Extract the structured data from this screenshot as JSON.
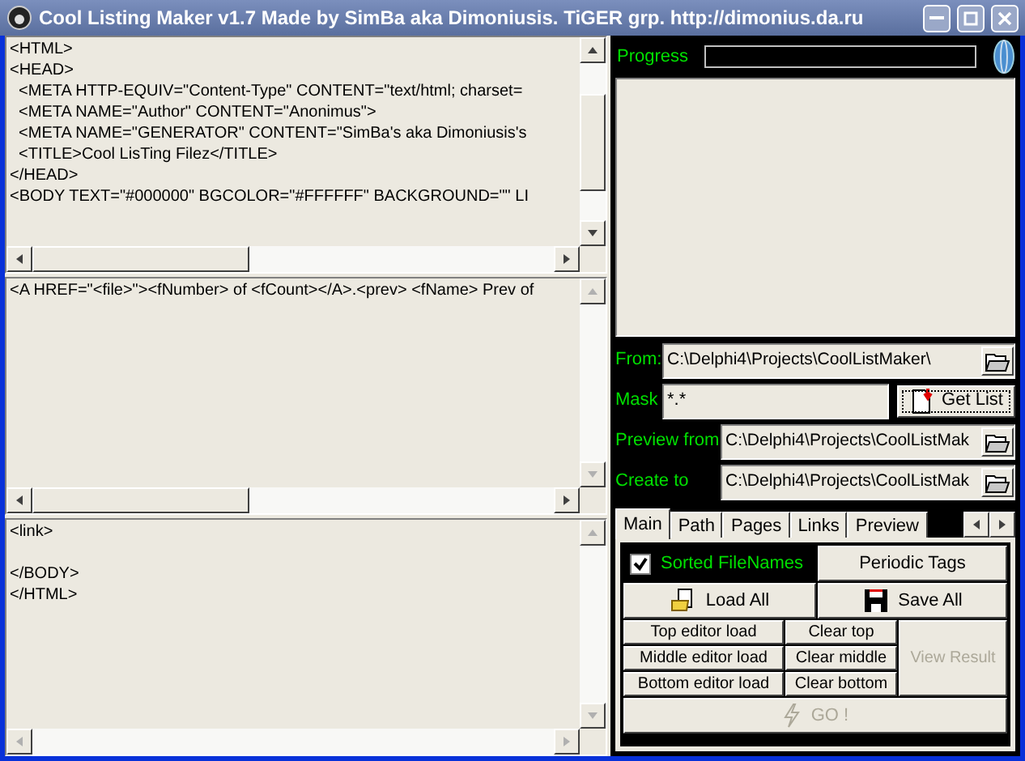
{
  "window": {
    "title": "Cool Listing Maker v1.7 Made by SimBa aka Dimoniusis. TiGER grp. http://dimonius.da.ru"
  },
  "editors": [
    {
      "text": "<HTML>\n<HEAD>\n  <META HTTP-EQUIV=\"Content-Type\" CONTENT=\"text/html; charset=\n  <META NAME=\"Author\" CONTENT=\"Anonimus\">\n  <META NAME=\"GENERATOR\" CONTENT=\"SimBa's aka Dimoniusis's\n  <TITLE>Cool LisTing Filez</TITLE>\n</HEAD>\n<BODY TEXT=\"#000000\" BGCOLOR=\"#FFFFFF\" BACKGROUND=\"\" LI",
      "vscroll": true,
      "hscroll": true
    },
    {
      "text": "<A HREF=\"<file>\"><fNumber> of <fCount></A>.<prev> <fName> Prev of",
      "vscroll": false,
      "hscroll": true
    },
    {
      "text": "<link>\n\n</BODY>\n</HTML>",
      "vscroll": false,
      "hscroll": false
    }
  ],
  "progress": {
    "label": "Progress",
    "level": 0
  },
  "fields": [
    {
      "kind": "path",
      "label": "From:",
      "value": "C:\\Delphi4\\Projects\\CoolListMaker\\"
    },
    {
      "kind": "mask",
      "label": "Mask",
      "value": "*.*",
      "button": "Get List"
    },
    {
      "kind": "path",
      "label": "Preview from",
      "value": "C:\\Delphi4\\Projects\\CoolListMak"
    },
    {
      "kind": "path",
      "label": "Create to",
      "value": "C:\\Delphi4\\Projects\\CoolListMak"
    }
  ],
  "tabs": [
    {
      "label": "Main",
      "selected": true
    },
    {
      "label": "Path",
      "selected": false
    },
    {
      "label": "Pages",
      "selected": false
    },
    {
      "label": "Links",
      "selected": false
    },
    {
      "label": "Preview",
      "selected": false
    }
  ],
  "main_tab": {
    "sorted": {
      "label": "Sorted FileNames",
      "checked": true
    },
    "periodic_tags": {
      "label": "Periodic Tags",
      "disabled": false
    },
    "load_all": {
      "label": "Load All",
      "disabled": false
    },
    "save_all": {
      "label": "Save All",
      "disabled": false
    },
    "editor_rows": [
      {
        "load": "Top editor load",
        "clear": "Clear top"
      },
      {
        "load": "Middle editor load",
        "clear": "Clear middle"
      },
      {
        "load": "Bottom editor load",
        "clear": "Clear bottom"
      }
    ],
    "view_result": {
      "label": "View Result",
      "disabled": true
    },
    "go": {
      "label": "GO !",
      "disabled": true
    }
  }
}
